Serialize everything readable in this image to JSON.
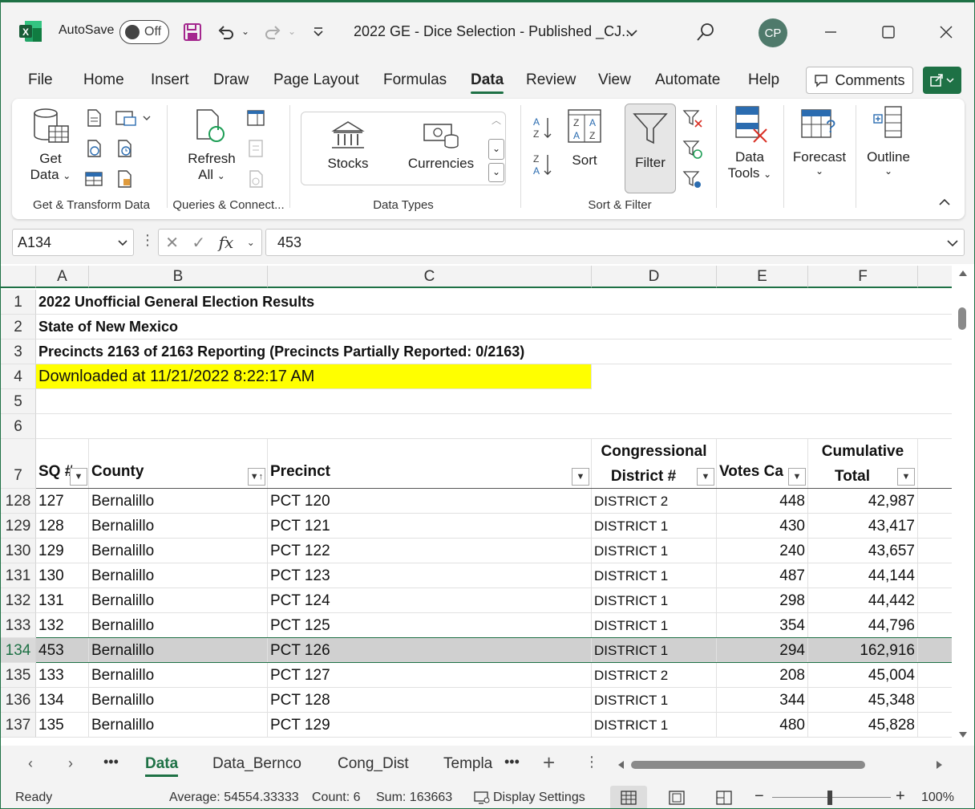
{
  "window": {
    "autosave_label": "AutoSave",
    "autosave_state": "Off",
    "doc_title": "2022 GE - Dice Selection - Published _CJ...",
    "avatar_initials": "CP",
    "accent": "#1e7145"
  },
  "menu": {
    "tabs": [
      "File",
      "Home",
      "Insert",
      "Draw",
      "Page Layout",
      "Formulas",
      "Data",
      "Review",
      "View",
      "Automate",
      "Help"
    ],
    "active": "Data",
    "comments_label": "Comments"
  },
  "ribbon": {
    "get_data_line1": "Get",
    "get_data_line2": "Data",
    "refresh_line1": "Refresh",
    "refresh_line2": "All",
    "stocks": "Stocks",
    "currencies": "Currencies",
    "sort": "Sort",
    "filter": "Filter",
    "data_tools_line1": "Data",
    "data_tools_line2": "Tools",
    "forecast": "Forecast",
    "outline": "Outline",
    "groups": {
      "get_transform": "Get & Transform Data",
      "queries": "Queries & Connect...",
      "data_types": "Data Types",
      "sort_filter": "Sort & Filter"
    }
  },
  "formula_bar": {
    "name_box": "A134",
    "fx_symbol": "fx",
    "value": "453"
  },
  "grid": {
    "columns": [
      "A",
      "B",
      "C",
      "D",
      "E",
      "F"
    ],
    "header_rows": [
      {
        "row": "1",
        "text": "2022 Unofficial General Election Results"
      },
      {
        "row": "2",
        "text": "State of New Mexico"
      },
      {
        "row": "3",
        "text": "Precincts 2163 of 2163 Reporting (Precincts Partially Reported: 0/2163)"
      },
      {
        "row": "4",
        "text": "Downloaded at 11/21/2022 8:22:17 AM"
      },
      {
        "row": "5",
        "text": ""
      },
      {
        "row": "6",
        "text": ""
      }
    ],
    "table_header": {
      "row": "7",
      "a": "SQ #",
      "b": "County",
      "c": "Precinct",
      "d_line1": "Congressional",
      "d_line2": "District #",
      "e": "Votes Ca",
      "f_line1": "Cumulative",
      "f_line2": "Total"
    },
    "rows": [
      {
        "row": "128",
        "a": "127",
        "b": "Bernalillo",
        "c": "PCT 120",
        "d": "DISTRICT 2",
        "e": "448",
        "f": "42,987"
      },
      {
        "row": "129",
        "a": "128",
        "b": "Bernalillo",
        "c": "PCT 121",
        "d": "DISTRICT 1",
        "e": "430",
        "f": "43,417"
      },
      {
        "row": "130",
        "a": "129",
        "b": "Bernalillo",
        "c": "PCT 122",
        "d": "DISTRICT 1",
        "e": "240",
        "f": "43,657"
      },
      {
        "row": "131",
        "a": "130",
        "b": "Bernalillo",
        "c": "PCT 123",
        "d": "DISTRICT 1",
        "e": "487",
        "f": "44,144"
      },
      {
        "row": "132",
        "a": "131",
        "b": "Bernalillo",
        "c": "PCT 124",
        "d": "DISTRICT 1",
        "e": "298",
        "f": "44,442"
      },
      {
        "row": "133",
        "a": "132",
        "b": "Bernalillo",
        "c": "PCT 125",
        "d": "DISTRICT 1",
        "e": "354",
        "f": "44,796"
      },
      {
        "row": "134",
        "a": "453",
        "b": "Bernalillo",
        "c": "PCT 126",
        "d": "DISTRICT 1",
        "e": "294",
        "f": "162,916"
      },
      {
        "row": "135",
        "a": "133",
        "b": "Bernalillo",
        "c": "PCT 127",
        "d": "DISTRICT 2",
        "e": "208",
        "f": "45,004"
      },
      {
        "row": "136",
        "a": "134",
        "b": "Bernalillo",
        "c": "PCT 128",
        "d": "DISTRICT 1",
        "e": "344",
        "f": "45,348"
      },
      {
        "row": "137",
        "a": "135",
        "b": "Bernalillo",
        "c": "PCT 129",
        "d": "DISTRICT 1",
        "e": "480",
        "f": "45,828"
      }
    ],
    "selected_row": "134",
    "highlight_color": "#ffff00"
  },
  "sheets": {
    "tabs": [
      "Data",
      "Data_Bernco",
      "Cong_Dist",
      "Templa"
    ],
    "active": "Data"
  },
  "status": {
    "ready": "Ready",
    "average": "Average: 54554.33333",
    "count": "Count: 6",
    "sum": "Sum: 163663",
    "display_settings": "Display Settings",
    "zoom": "100%"
  }
}
